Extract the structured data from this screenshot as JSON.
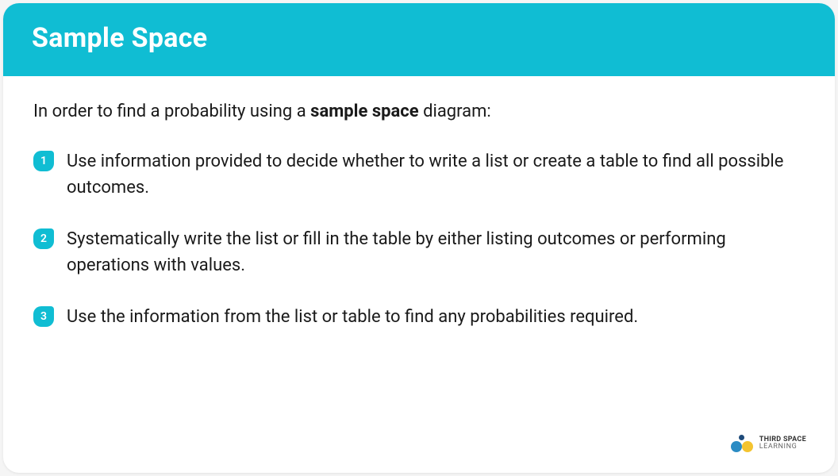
{
  "header": {
    "title": "Sample Space"
  },
  "intro": {
    "prefix": "In order to find a probability using a ",
    "bold": "sample space",
    "suffix": " diagram:"
  },
  "steps": [
    {
      "number": "1",
      "text": "Use information provided to decide whether to write a list or create a table to find all possible outcomes."
    },
    {
      "number": "2",
      "text": "Systematically write the list or fill in the table by either listing outcomes or performing operations with values."
    },
    {
      "number": "3",
      "text": "Use the information from the list or table to find any probabilities required."
    }
  ],
  "logo": {
    "line1": "THIRD SPACE",
    "line2": "LEARNING"
  }
}
